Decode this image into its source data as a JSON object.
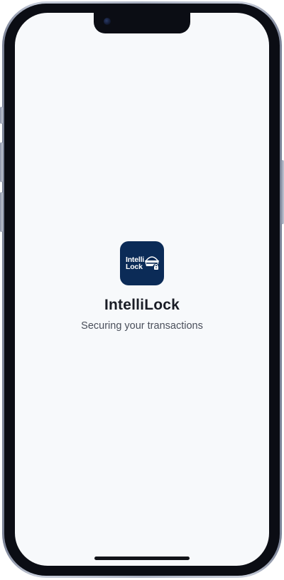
{
  "app": {
    "icon_text_line1": "Intelli",
    "icon_text_line2": "Lock",
    "title": "IntelliLock",
    "tagline": "Securing your transactions"
  },
  "colors": {
    "icon_background": "#0b2b57",
    "screen_background": "#f7f9fb",
    "title_text": "#1a1d26",
    "tagline_text": "#4a4f5b"
  },
  "icons": {
    "app_glyph": "basket-lock-icon"
  }
}
